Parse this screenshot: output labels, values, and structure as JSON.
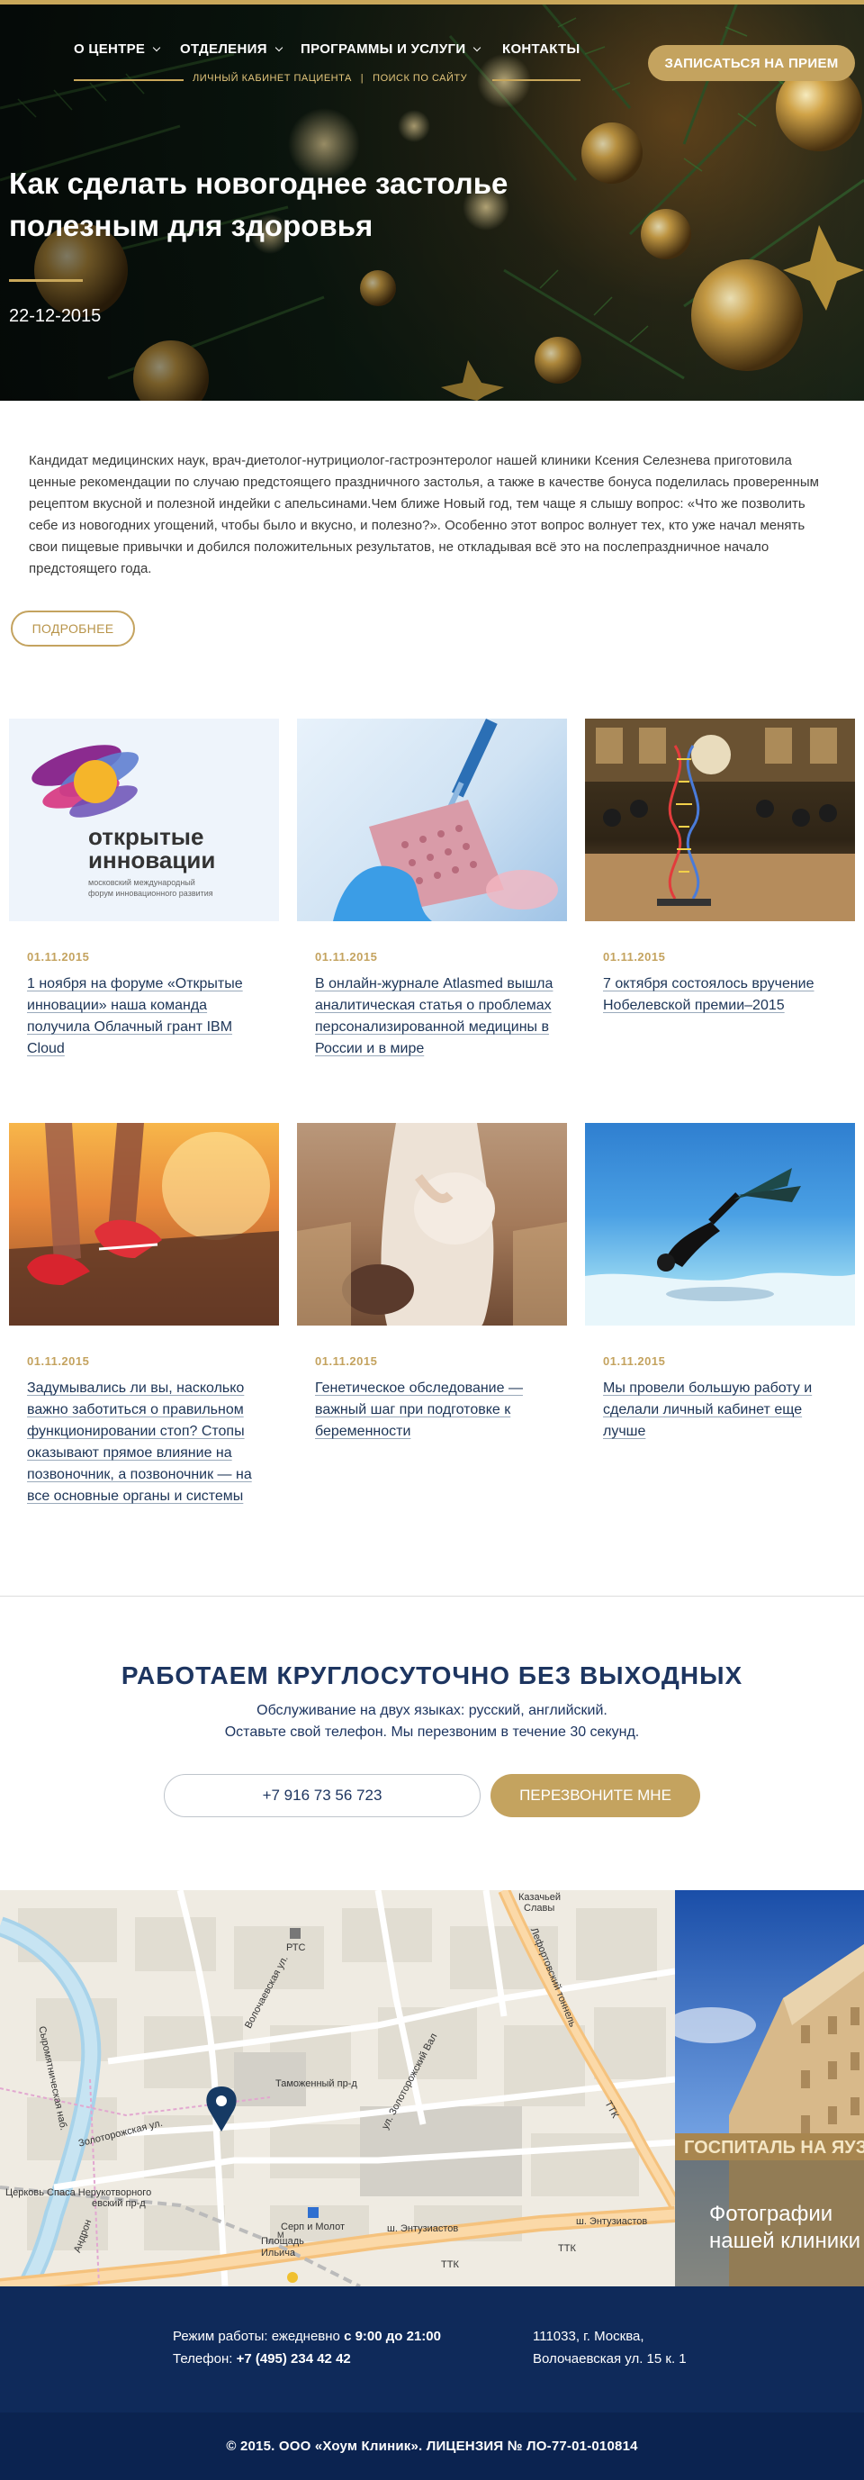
{
  "nav": {
    "items": [
      {
        "label": "О ЦЕНТРЕ"
      },
      {
        "label": "ОТДЕЛЕНИЯ"
      },
      {
        "label": "ПРОГРАММЫ И УСЛУГИ"
      },
      {
        "label": "КОНТАКТЫ"
      }
    ],
    "sub_links": {
      "cabinet": "ЛИЧНЫЙ КАБИНЕТ ПАЦИЕНТА",
      "separator": "|",
      "search": "ПОИСК ПО САЙТУ"
    },
    "cta": "ЗАПИСАТЬСЯ НА ПРИЕМ"
  },
  "hero": {
    "title": "Как сделать новогоднее застолье полезным для здоровья",
    "date": "22-12-2015"
  },
  "article": {
    "text": "Кандидат медицинских наук, врач-диетолог-нутрициолог-гастроэнтеролог нашей клиники Ксения Селезнева приготовила ценные рекомендации по случаю предстоящего праздничного застолья, а также в качестве бонуса поделилась проверенным рецептом вкусной и полезной индейки с апельсинами.Чем ближе Новый год, тем чаще я слышу вопрос: «Что же позволить себе из новогодних угощений, чтобы было и вкусно, и полезно?». Особенно этот вопрос волнует тех, кто уже начал менять свои пищевые привычки и добился положительных результатов, не откладывая всё это на послепраздничное начало предстоящего года.",
    "more": "ПОДРОБНЕЕ"
  },
  "news": [
    {
      "date": "01.11.2015",
      "title": "1 ноября на форуме «Открытые инновации» наша команда получила Облачный грант IBM Cloud",
      "logo_title": "открытые инновации",
      "logo_sub": "московский международный форум инновационного развития"
    },
    {
      "date": "01.11.2015",
      "title": "В онлайн-журнале Atlasmed вышла аналитическая статья о проблемах персонализированной медицины в России и в мире"
    },
    {
      "date": "01.11.2015",
      "title": "7 октября состоялось вручение Нобелевской премии–2015"
    },
    {
      "date": "01.11.2015",
      "title": "Задумывались ли вы, насколько важно заботиться о правильном функционировании стоп? Стопы оказывают прямое влияние на позвоночник, а позвоночник — на все основные органы и системы"
    },
    {
      "date": "01.11.2015",
      "title": "Генетическое обследование — важный шаг при подготовке к беременности"
    },
    {
      "date": "01.11.2015",
      "title": "Мы провели большую работу и сделали личный кабинет еще лучше"
    }
  ],
  "support": {
    "title": "РАБОТАЕМ КРУГЛОСУТОЧНО БЕЗ ВЫХОДНЫХ",
    "line1": "Обслуживание на двух языках: русский, английский.",
    "line2": "Оставьте свой телефон. Мы перезвоним в течение 30 секунд.",
    "phone_value": "+7 916 73 56 723",
    "button": "ПЕРЕЗВОНИТЕ МНЕ"
  },
  "map": {
    "labels": {
      "syromyatnicheskaya": "Сыромятническая наб.",
      "volochaevskaya": "Волочаевская ул.",
      "tamozhenny": "Таможенный пр-д",
      "zolotorozhsky_val": "ул. Золоторожский Вал",
      "lefortovo": "Лефортовский тоннель",
      "ttk": "ТТК",
      "zolotorozhskaya": "Золоторожская ул.",
      "entuziastov1": "ш. Энтузиастов",
      "entuziastov2": "ш. Энтузиастов",
      "church": "Церковь Спаса Нерукотворного",
      "proezd": "евский пр-д",
      "serp_molot": "Серп и Молот",
      "ploshad": "Площадь",
      "ilyicha": "Ильича",
      "rts": "РТС",
      "kazachyi": "Казачьей",
      "slavy": "Славы",
      "andron": "Андрон",
      "ttk2": "ТТК",
      "ttk3": "ТТК"
    }
  },
  "photos": {
    "caption_line1": "Фотографии",
    "caption_line2": "нашей клиники",
    "sign": "ГОСПИТАЛЬ НА ЯУЗЕ"
  },
  "footer": {
    "hours_prefix": "Режим работы: ежедневно ",
    "hours": "с 9:00 до 21:00",
    "phone_prefix": "Телефон: ",
    "phone": "+7 (495) 234 42 42",
    "address1": "111033, г. Москва,",
    "address2": "Волочаевская ул. 15 к. 1",
    "copyright": "© 2015. ООО «Хоум Клиник». ЛИЦЕНЗИЯ № ЛО-77-01-010814"
  },
  "colors": {
    "gold": "#c4a35f",
    "navy": "#0f2a5a",
    "link": "#1d3557"
  }
}
